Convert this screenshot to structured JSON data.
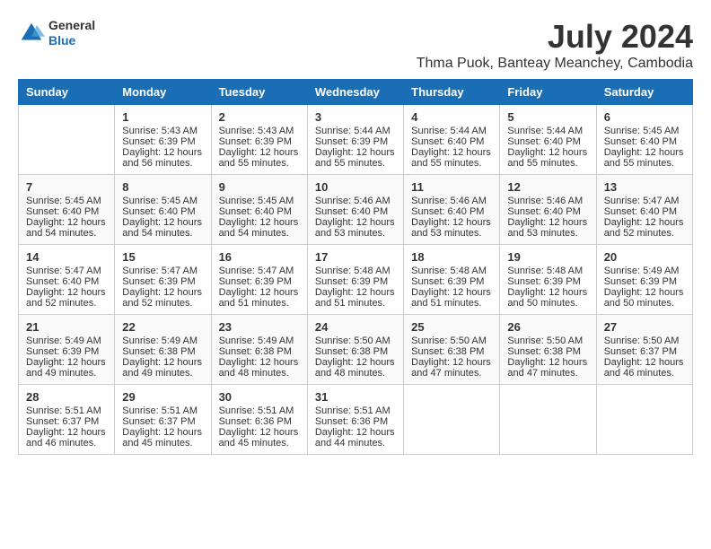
{
  "header": {
    "logo": {
      "general": "General",
      "blue": "Blue"
    },
    "title": "July 2024",
    "location": "Thma Puok, Banteay Meanchey, Cambodia"
  },
  "calendar": {
    "days_of_week": [
      "Sunday",
      "Monday",
      "Tuesday",
      "Wednesday",
      "Thursday",
      "Friday",
      "Saturday"
    ],
    "weeks": [
      [
        {
          "day": "",
          "sunrise": "",
          "sunset": "",
          "daylight": ""
        },
        {
          "day": "1",
          "sunrise": "Sunrise: 5:43 AM",
          "sunset": "Sunset: 6:39 PM",
          "daylight": "Daylight: 12 hours and 56 minutes."
        },
        {
          "day": "2",
          "sunrise": "Sunrise: 5:43 AM",
          "sunset": "Sunset: 6:39 PM",
          "daylight": "Daylight: 12 hours and 55 minutes."
        },
        {
          "day": "3",
          "sunrise": "Sunrise: 5:44 AM",
          "sunset": "Sunset: 6:39 PM",
          "daylight": "Daylight: 12 hours and 55 minutes."
        },
        {
          "day": "4",
          "sunrise": "Sunrise: 5:44 AM",
          "sunset": "Sunset: 6:40 PM",
          "daylight": "Daylight: 12 hours and 55 minutes."
        },
        {
          "day": "5",
          "sunrise": "Sunrise: 5:44 AM",
          "sunset": "Sunset: 6:40 PM",
          "daylight": "Daylight: 12 hours and 55 minutes."
        },
        {
          "day": "6",
          "sunrise": "Sunrise: 5:45 AM",
          "sunset": "Sunset: 6:40 PM",
          "daylight": "Daylight: 12 hours and 55 minutes."
        }
      ],
      [
        {
          "day": "7",
          "sunrise": "Sunrise: 5:45 AM",
          "sunset": "Sunset: 6:40 PM",
          "daylight": "Daylight: 12 hours and 54 minutes."
        },
        {
          "day": "8",
          "sunrise": "Sunrise: 5:45 AM",
          "sunset": "Sunset: 6:40 PM",
          "daylight": "Daylight: 12 hours and 54 minutes."
        },
        {
          "day": "9",
          "sunrise": "Sunrise: 5:45 AM",
          "sunset": "Sunset: 6:40 PM",
          "daylight": "Daylight: 12 hours and 54 minutes."
        },
        {
          "day": "10",
          "sunrise": "Sunrise: 5:46 AM",
          "sunset": "Sunset: 6:40 PM",
          "daylight": "Daylight: 12 hours and 53 minutes."
        },
        {
          "day": "11",
          "sunrise": "Sunrise: 5:46 AM",
          "sunset": "Sunset: 6:40 PM",
          "daylight": "Daylight: 12 hours and 53 minutes."
        },
        {
          "day": "12",
          "sunrise": "Sunrise: 5:46 AM",
          "sunset": "Sunset: 6:40 PM",
          "daylight": "Daylight: 12 hours and 53 minutes."
        },
        {
          "day": "13",
          "sunrise": "Sunrise: 5:47 AM",
          "sunset": "Sunset: 6:40 PM",
          "daylight": "Daylight: 12 hours and 52 minutes."
        }
      ],
      [
        {
          "day": "14",
          "sunrise": "Sunrise: 5:47 AM",
          "sunset": "Sunset: 6:40 PM",
          "daylight": "Daylight: 12 hours and 52 minutes."
        },
        {
          "day": "15",
          "sunrise": "Sunrise: 5:47 AM",
          "sunset": "Sunset: 6:39 PM",
          "daylight": "Daylight: 12 hours and 52 minutes."
        },
        {
          "day": "16",
          "sunrise": "Sunrise: 5:47 AM",
          "sunset": "Sunset: 6:39 PM",
          "daylight": "Daylight: 12 hours and 51 minutes."
        },
        {
          "day": "17",
          "sunrise": "Sunrise: 5:48 AM",
          "sunset": "Sunset: 6:39 PM",
          "daylight": "Daylight: 12 hours and 51 minutes."
        },
        {
          "day": "18",
          "sunrise": "Sunrise: 5:48 AM",
          "sunset": "Sunset: 6:39 PM",
          "daylight": "Daylight: 12 hours and 51 minutes."
        },
        {
          "day": "19",
          "sunrise": "Sunrise: 5:48 AM",
          "sunset": "Sunset: 6:39 PM",
          "daylight": "Daylight: 12 hours and 50 minutes."
        },
        {
          "day": "20",
          "sunrise": "Sunrise: 5:49 AM",
          "sunset": "Sunset: 6:39 PM",
          "daylight": "Daylight: 12 hours and 50 minutes."
        }
      ],
      [
        {
          "day": "21",
          "sunrise": "Sunrise: 5:49 AM",
          "sunset": "Sunset: 6:39 PM",
          "daylight": "Daylight: 12 hours and 49 minutes."
        },
        {
          "day": "22",
          "sunrise": "Sunrise: 5:49 AM",
          "sunset": "Sunset: 6:38 PM",
          "daylight": "Daylight: 12 hours and 49 minutes."
        },
        {
          "day": "23",
          "sunrise": "Sunrise: 5:49 AM",
          "sunset": "Sunset: 6:38 PM",
          "daylight": "Daylight: 12 hours and 48 minutes."
        },
        {
          "day": "24",
          "sunrise": "Sunrise: 5:50 AM",
          "sunset": "Sunset: 6:38 PM",
          "daylight": "Daylight: 12 hours and 48 minutes."
        },
        {
          "day": "25",
          "sunrise": "Sunrise: 5:50 AM",
          "sunset": "Sunset: 6:38 PM",
          "daylight": "Daylight: 12 hours and 47 minutes."
        },
        {
          "day": "26",
          "sunrise": "Sunrise: 5:50 AM",
          "sunset": "Sunset: 6:38 PM",
          "daylight": "Daylight: 12 hours and 47 minutes."
        },
        {
          "day": "27",
          "sunrise": "Sunrise: 5:50 AM",
          "sunset": "Sunset: 6:37 PM",
          "daylight": "Daylight: 12 hours and 46 minutes."
        }
      ],
      [
        {
          "day": "28",
          "sunrise": "Sunrise: 5:51 AM",
          "sunset": "Sunset: 6:37 PM",
          "daylight": "Daylight: 12 hours and 46 minutes."
        },
        {
          "day": "29",
          "sunrise": "Sunrise: 5:51 AM",
          "sunset": "Sunset: 6:37 PM",
          "daylight": "Daylight: 12 hours and 45 minutes."
        },
        {
          "day": "30",
          "sunrise": "Sunrise: 5:51 AM",
          "sunset": "Sunset: 6:36 PM",
          "daylight": "Daylight: 12 hours and 45 minutes."
        },
        {
          "day": "31",
          "sunrise": "Sunrise: 5:51 AM",
          "sunset": "Sunset: 6:36 PM",
          "daylight": "Daylight: 12 hours and 44 minutes."
        },
        {
          "day": "",
          "sunrise": "",
          "sunset": "",
          "daylight": ""
        },
        {
          "day": "",
          "sunrise": "",
          "sunset": "",
          "daylight": ""
        },
        {
          "day": "",
          "sunrise": "",
          "sunset": "",
          "daylight": ""
        }
      ]
    ]
  }
}
